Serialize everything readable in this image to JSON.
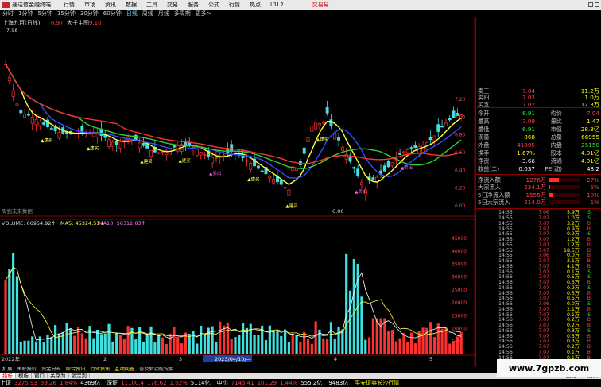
{
  "menubar": {
    "app_name": "通达信金融终端",
    "items": [
      "行情",
      "市场",
      "资讯",
      "数据",
      "工具",
      "交易",
      "服务",
      "公式",
      "行情",
      "热点",
      "L1L2"
    ],
    "brand": "交易易"
  },
  "periodbar": {
    "items": [
      "分时",
      "1分钟",
      "5分钟",
      "15分钟",
      "30分钟",
      "60分钟",
      "日线",
      "周线",
      "月线",
      "多周期",
      "更多>"
    ],
    "active": "日线"
  },
  "chart": {
    "header": "上海九百(日线)",
    "header_price": "6.97",
    "header_tag": "大千主图",
    "header_value2": "9.10",
    "top_price_label": "7.98",
    "low_price_label": "6.00",
    "future_label": "周到未来数据",
    "price_axis": [
      "7.20",
      "7.00",
      "6.80",
      "6.60",
      "6.40",
      "6.20",
      "6.00"
    ],
    "price_axis_vals": [
      7.2,
      7.0,
      6.8,
      6.6,
      6.4,
      6.2,
      6.0
    ],
    "vol_axis": [
      "45000",
      "40000",
      "35000",
      "30000",
      "25000",
      "20000",
      "15000",
      "10000",
      "5000"
    ],
    "vol_axis_vals": [
      45000,
      40000,
      35000,
      30000,
      25000,
      20000,
      15000,
      10000,
      5000
    ],
    "vol_label": "VOLUME: 66954.92↑",
    "ma5_label": "MA5: 45324.51↓",
    "ma10_label": "MA10: 56312.03↑",
    "vol_marker": "40207",
    "date_start": "2022年",
    "date_cursor": "2023/04/10/—",
    "date_months": [
      "2",
      "3",
      "4",
      "5"
    ],
    "signal_buy": "建买",
    "signal_sell": "卖出",
    "colors": {
      "up": "#ff3030",
      "down": "#40e0e0",
      "ma_yellow": "#ffff40",
      "ma_blue": "#3050ff",
      "ma_green": "#30d030",
      "ma_red": "#ff3030",
      "vol_ma": "#ffffff"
    }
  },
  "quote": {
    "asks": [
      {
        "label": "卖三",
        "price": "7.04",
        "vol": "11.2万"
      },
      {
        "label": "卖四",
        "price": "7.03",
        "vol": "1.0万"
      },
      {
        "label": "买五",
        "price": "7.02",
        "vol": "12.3万"
      }
    ],
    "stats": [
      {
        "l": "今开",
        "v": "6.91",
        "vc": "grn",
        "l2": "均价",
        "v2": "7.04",
        "v2c": "red"
      },
      {
        "l": "最高",
        "v": "7.09",
        "vc": "red",
        "l2": "量比",
        "v2": "1.47",
        "v2c": "yel"
      },
      {
        "l": "最低",
        "v": "6.91",
        "vc": "grn",
        "l2": "市值",
        "v2": "28.3亿",
        "v2c": "yel"
      },
      {
        "l": "现量",
        "v": "868",
        "vc": "yel",
        "l2": "总量",
        "v2": "66955",
        "v2c": "yel"
      },
      {
        "l": "外盘",
        "v": "41805",
        "vc": "red",
        "l2": "内盘",
        "v2": "25150",
        "v2c": "grn"
      },
      {
        "l": "换手",
        "v": "1.67%",
        "vc": "yel",
        "l2": "股本",
        "v2": "4.01亿",
        "v2c": "yel"
      },
      {
        "l": "净资",
        "v": "3.66",
        "vc": "wht",
        "l2": "流通",
        "v2": "4.01亿",
        "v2c": "yel"
      },
      {
        "l": "收益(二)",
        "v": "0.037",
        "vc": "wht",
        "l2": "PE(动)",
        "v2": "48.2",
        "v2c": "wht"
      }
    ],
    "flows": [
      {
        "l": "净流入额",
        "v": "1276万",
        "p": "27%",
        "pct": 0.27
      },
      {
        "l": "大宗流入",
        "v": "234.1万",
        "p": "5%",
        "pct": 0.05
      },
      {
        "l": "5日净流入额",
        "v": "1555万",
        "p": "10%",
        "pct": 0.1
      },
      {
        "l": "5日大宗流入",
        "v": "214.0万",
        "p": "1%",
        "pct": 0.01
      }
    ],
    "ticks": [
      {
        "t": "14:55",
        "p": "7.06",
        "v": "5.9万",
        "bs": "S"
      },
      {
        "t": "14:55",
        "p": "7.07",
        "v": "1.0万",
        "bs": "S"
      },
      {
        "t": "14:55",
        "p": "7.07",
        "v": "3.2万",
        "bs": "B"
      },
      {
        "t": "14:55",
        "p": "7.07",
        "v": "0.9万",
        "bs": "B"
      },
      {
        "t": "14:55",
        "p": "7.07",
        "v": "0.9万",
        "bs": "S"
      },
      {
        "t": "14:55",
        "p": "7.07",
        "v": "1.2万",
        "bs": "B"
      },
      {
        "t": "14:55",
        "p": "7.07",
        "v": "1.2万",
        "bs": "B"
      },
      {
        "t": "14:55",
        "p": "7.07",
        "v": "18.5万",
        "bs": "B"
      },
      {
        "t": "14:55",
        "p": "7.06",
        "v": "0.0万",
        "bs": "B"
      },
      {
        "t": "14:55",
        "p": "7.07",
        "v": "2.1万",
        "bs": "B"
      },
      {
        "t": "14:56",
        "p": "7.07",
        "v": "4.1万",
        "bs": "B"
      },
      {
        "t": "14:56",
        "p": "7.07",
        "v": "0.1万",
        "bs": "S"
      },
      {
        "t": "14:56",
        "p": "7.07",
        "v": "0.5万",
        "bs": "S"
      },
      {
        "t": "14:56",
        "p": "7.07",
        "v": "0.3万",
        "bs": "B"
      },
      {
        "t": "14:56",
        "p": "7.07",
        "v": "0.9万",
        "bs": "S"
      },
      {
        "t": "14:56",
        "p": "7.07",
        "v": "0.3万",
        "bs": "B"
      },
      {
        "t": "14:56",
        "p": "7.07",
        "v": "0.5万",
        "bs": "B"
      },
      {
        "t": "14:56",
        "p": "7.06",
        "v": "0.0万",
        "bs": "S"
      },
      {
        "t": "14:56",
        "p": "7.07",
        "v": "2.1万",
        "bs": "B"
      },
      {
        "t": "14:56",
        "p": "7.07",
        "v": "0.1万",
        "bs": "S"
      },
      {
        "t": "14:56",
        "p": "7.07",
        "v": "0.2万",
        "bs": "B"
      },
      {
        "t": "14:56",
        "p": "7.07",
        "v": "0.2万",
        "bs": "B"
      },
      {
        "t": "14:56",
        "p": "7.07",
        "v": "0.3万",
        "bs": "S"
      },
      {
        "t": "14:56",
        "p": "7.07",
        "v": "0.5万",
        "bs": "B"
      },
      {
        "t": "14:56",
        "p": "7.07",
        "v": "0.3万",
        "bs": "B"
      },
      {
        "t": "14:56",
        "p": "7.07",
        "v": "0.2万",
        "bs": "B"
      },
      {
        "t": "14:56",
        "p": "7.07",
        "v": "0.1万",
        "bs": "B"
      },
      {
        "t": "14:56",
        "p": "7.07",
        "v": "0.1万",
        "bs": "B"
      },
      {
        "t": "14:56",
        "p": "7.07",
        "v": "0.1万",
        "bs": "B"
      },
      {
        "t": "15:00",
        "p": "7.07",
        "v": "6.8万",
        "bs": "B"
      }
    ]
  },
  "tabsbar": {
    "items": [
      "指标",
      "模板",
      "窗口",
      "关存为",
      "锁定到"
    ],
    "right": "图交F10 剩余"
  },
  "tabsbar2": {
    "items": [
      "扩展",
      "关联报价",
      "资金分布",
      "综合资讯",
      "行业资讯",
      "互动问答",
      "普及新功能说明"
    ]
  },
  "statusbar": {
    "items": [
      {
        "name": "上证",
        "v": "3275.93",
        "c": "59.26",
        "p": "1.84%",
        "amt": "4369亿"
      },
      {
        "name": "深证",
        "v": "11100.4",
        "c": "176.62",
        "p": "1.62%",
        "amt": "5114亿"
      },
      {
        "name": "中小",
        "v": "7145.41",
        "c": "101.29",
        "p": "1.44%",
        "amt": "555.2亿"
      },
      {
        "name": "创业",
        "v": "",
        "c": "",
        "p": "",
        "amt": "9483亿"
      }
    ],
    "news": "平安证券长沙行情"
  },
  "watermark": "www.7gpzb.com"
}
